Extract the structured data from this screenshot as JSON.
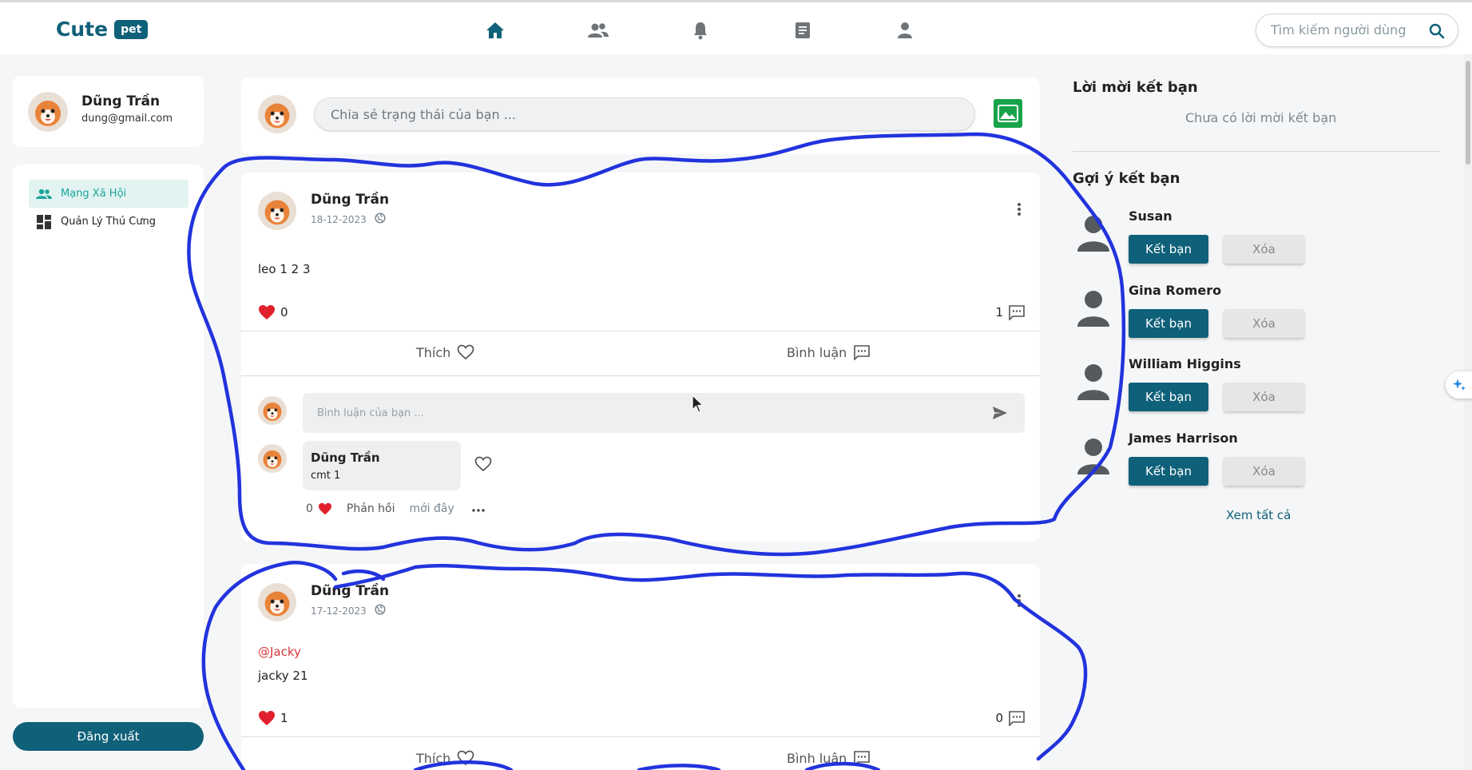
{
  "app": {
    "logo_text": "Cute",
    "logo_badge": "pet"
  },
  "nav": {
    "icons": [
      "home-icon",
      "friends-icon",
      "bell-icon",
      "document-icon",
      "person-icon"
    ],
    "active_color": "#0f6079"
  },
  "search": {
    "placeholder": "Tìm kiếm người dùng"
  },
  "profile": {
    "name": "Dũng Trần",
    "email": "dung@gmail.com"
  },
  "menu": {
    "items": [
      {
        "label": "Mạng Xã Hội",
        "icon": "group-icon",
        "active": true
      },
      {
        "label": "Quản Lý Thú Cưng",
        "icon": "dashboard-icon",
        "active": false
      }
    ]
  },
  "logout_label": "Đăng xuất",
  "compose": {
    "placeholder": "Chia sẻ trạng thái của bạn ..."
  },
  "posts": [
    {
      "author": "Dũng Trần",
      "date": "18-12-2023",
      "text": "leo 1 2 3",
      "likes": "0",
      "comments": "1",
      "like_label": "Thích",
      "comment_label": "Bình luận",
      "comment_placeholder": "Bình luận của bạn ...",
      "comment": {
        "author": "Dũng Trần",
        "text": "cmt 1",
        "likes": "0",
        "reply_label": "Phản hồi",
        "time": "mới đây"
      }
    },
    {
      "author": "Dũng Trần",
      "date": "17-12-2023",
      "tag": "@Jacky",
      "text": "jacky 21",
      "likes": "1",
      "comments": "0",
      "like_label": "Thích",
      "comment_label": "Bình luận"
    }
  ],
  "friend_requests": {
    "title": "Lời mời kết bạn",
    "empty_text": "Chưa có lời mời kết bạn"
  },
  "suggestions": {
    "title": "Gợi ý kết bạn",
    "add_label": "Kết bạn",
    "remove_label": "Xóa",
    "see_all": "Xem tất cả",
    "people": [
      {
        "name": "Susan"
      },
      {
        "name": "Gina Romero"
      },
      {
        "name": "William Higgins"
      },
      {
        "name": "James Harrison"
      }
    ]
  },
  "colors": {
    "primary": "#0f6079",
    "accent": "#1aa69b",
    "like": "#e0202c",
    "photo": "#18a34a",
    "annotation": "#2233dd"
  }
}
